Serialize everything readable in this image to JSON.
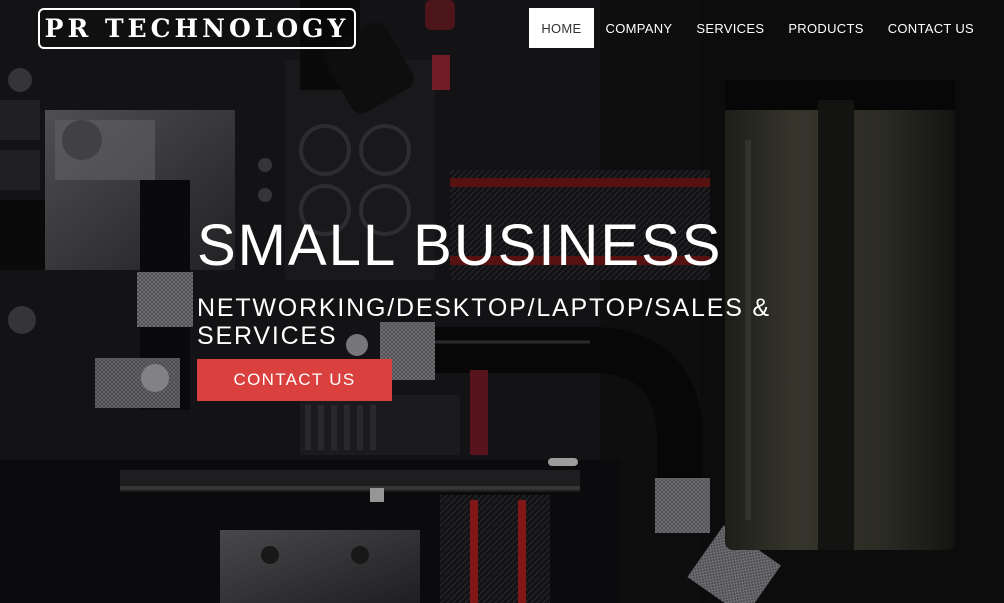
{
  "header": {
    "logo_text": "PR TECHNOLOGY",
    "nav": [
      {
        "label": "HOME",
        "active": true
      },
      {
        "label": "COMPANY",
        "active": false
      },
      {
        "label": "SERVICES",
        "active": false
      },
      {
        "label": "PRODUCTS",
        "active": false
      },
      {
        "label": "CONTACT US",
        "active": false
      }
    ]
  },
  "hero": {
    "title": "SMALL BUSINESS",
    "subtitle": "NETWORKING/DESKTOP/LAPTOP/SALES & SERVICES",
    "cta_label": "CONTACT US",
    "background_image": "pc-water-cooling-build"
  },
  "colors": {
    "accent": "#d9403e",
    "nav_active_bg": "#ffffff",
    "nav_active_text": "#333333",
    "text": "#ffffff"
  }
}
